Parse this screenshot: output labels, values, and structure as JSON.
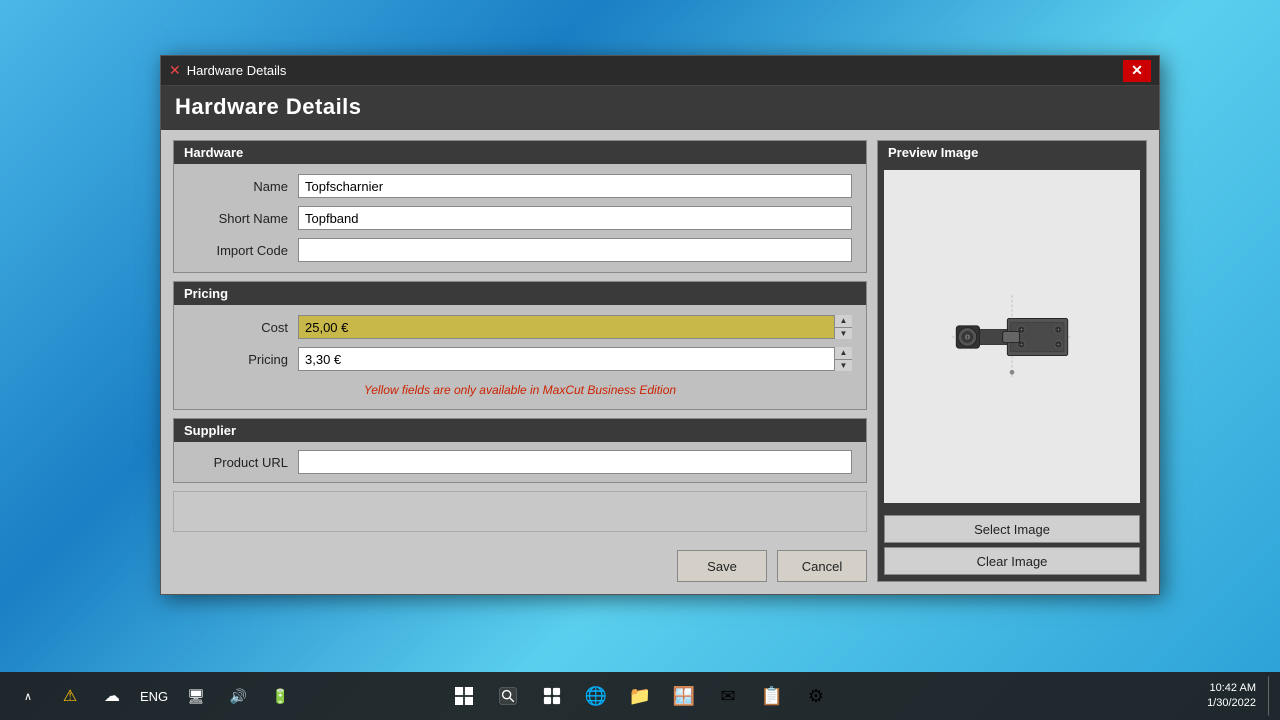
{
  "background": {
    "color": "#4ab8e8"
  },
  "titlebar": {
    "title": "Hardware Details",
    "icon": "✕",
    "close_btn": "✕"
  },
  "window": {
    "main_title": "Hardware Details"
  },
  "hardware_section": {
    "header": "Hardware",
    "name_label": "Name",
    "name_value": "Topfscharnier",
    "short_name_label": "Short Name",
    "short_name_value": "Topfband",
    "import_code_label": "Import Code",
    "import_code_value": ""
  },
  "pricing_section": {
    "header": "Pricing",
    "cost_label": "Cost",
    "cost_value": "25,00 €",
    "pricing_label": "Pricing",
    "pricing_value": "3,30 €",
    "warning_text": "Yellow fields are only available in MaxCut Business Edition"
  },
  "preview_section": {
    "header": "Preview Image",
    "select_btn": "Select Image",
    "clear_btn": "Clear Image"
  },
  "supplier_section": {
    "header": "Supplier",
    "product_url_label": "Product URL",
    "product_url_value": ""
  },
  "buttons": {
    "save": "Save",
    "cancel": "Cancel"
  },
  "taskbar": {
    "time": "10:42 AM",
    "date": "1/30/2022",
    "lang": "ENG"
  }
}
